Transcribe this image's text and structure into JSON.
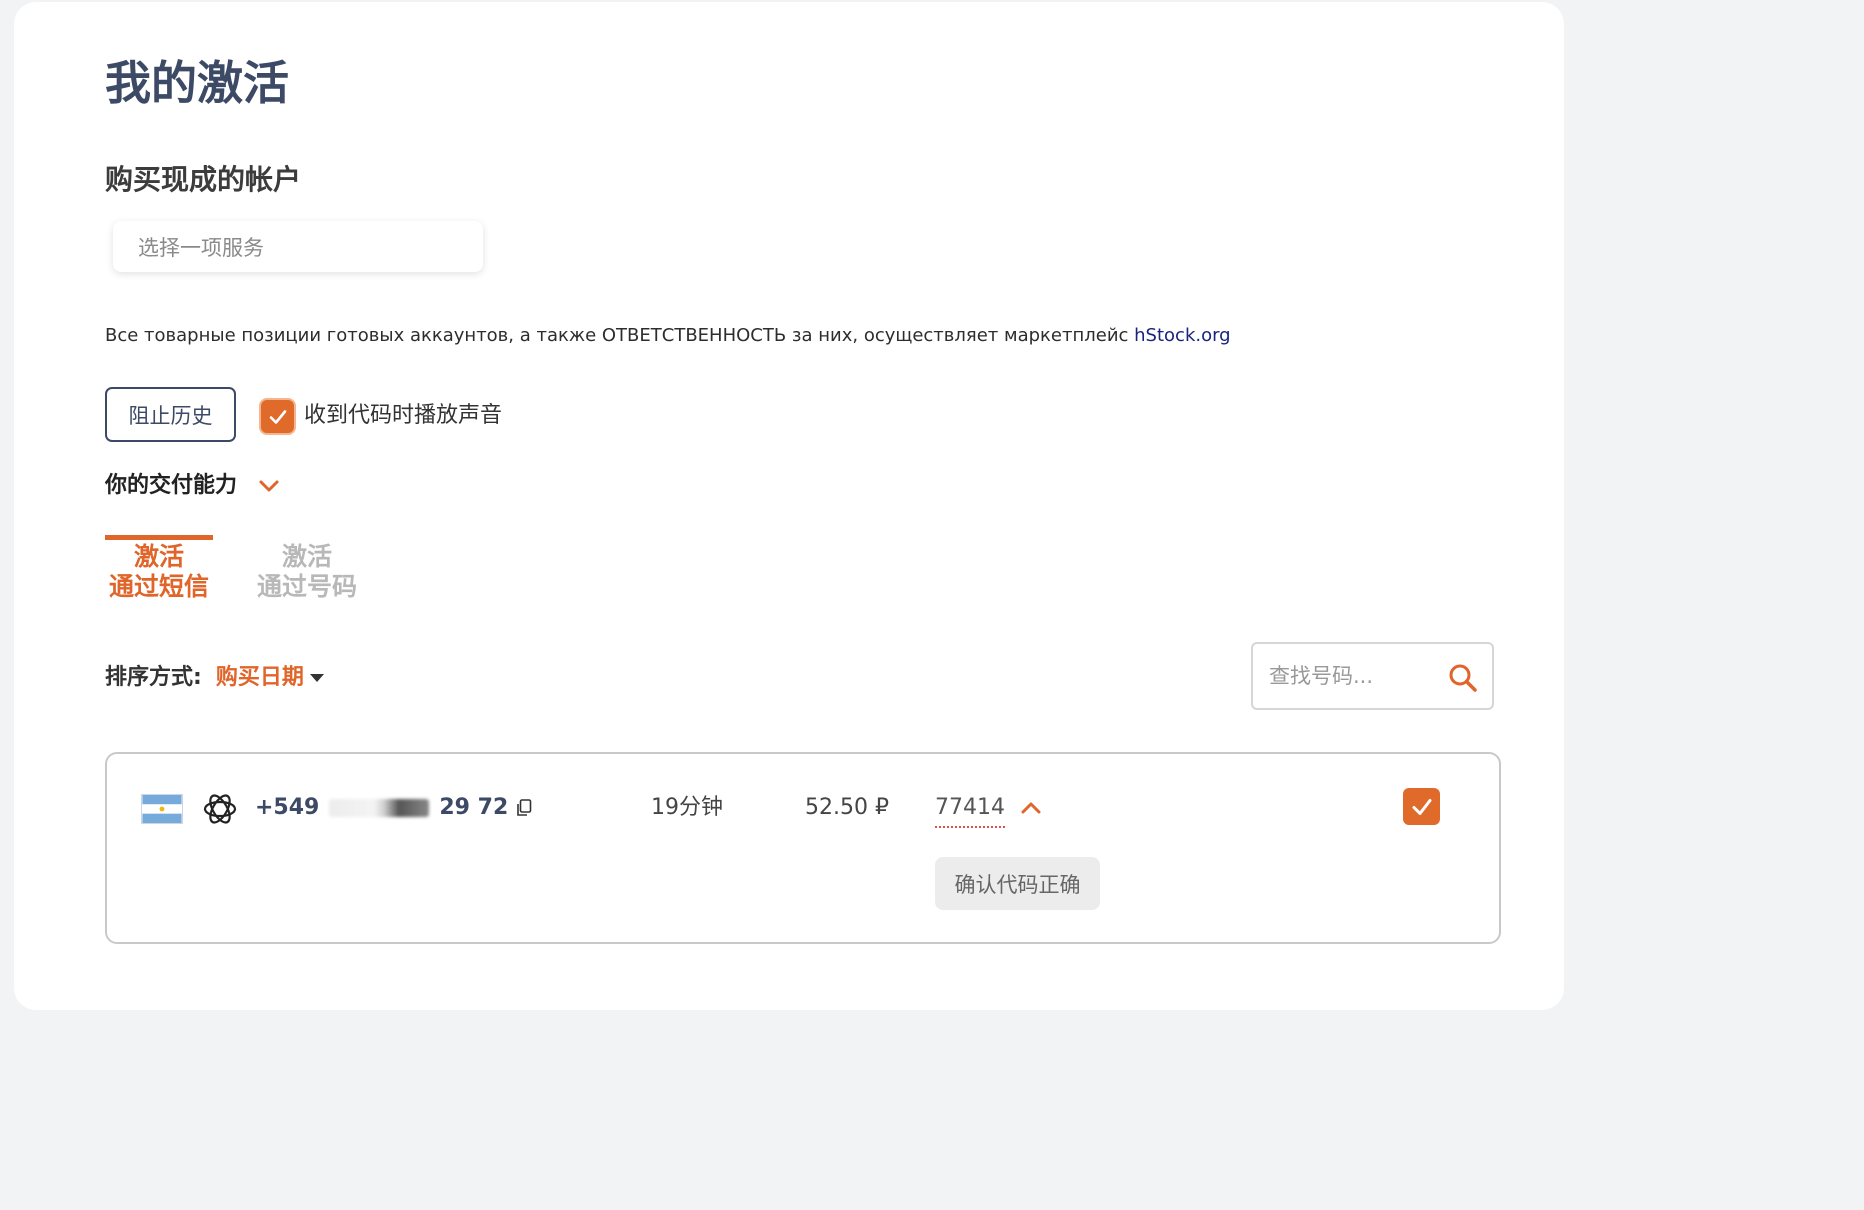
{
  "page": {
    "title": "我的激活"
  },
  "ready_accounts": {
    "title": "购买现成的帐户",
    "select_placeholder": "选择一项服务"
  },
  "disclaimer": {
    "text": "Все товарные позиции готовых аккаунтов, а также ОТВЕТСТВЕННОСТЬ за них, осуществляет маркетплейс ",
    "link_text": "hStock.org",
    "link_color": "#1a237e"
  },
  "controls": {
    "block_history_label": "阻止历史",
    "sound_checkbox_label": "收到代码时播放声音",
    "sound_checked": true,
    "delivery_ability_label": "你的交付能力"
  },
  "tabs": [
    {
      "line1": "激活",
      "line2": "通过短信",
      "active": true
    },
    {
      "line1": "激活",
      "line2": "通过号码",
      "active": false
    }
  ],
  "sort": {
    "label": "排序方式:",
    "value": "购买日期"
  },
  "search": {
    "placeholder": "查找号码..."
  },
  "activation": {
    "country_flag": "argentina-flag",
    "service_icon": "openai-icon",
    "phone_prefix": "+549",
    "phone_suffix": "29 72",
    "duration": "19分钟",
    "price": "52.50 ₽",
    "code": "77414",
    "confirm_label": "确认代码正确",
    "checked": true
  },
  "colors": {
    "accent": "#e0652a",
    "title": "#3d4a66",
    "inactive_tab": "#b8b8b8"
  }
}
